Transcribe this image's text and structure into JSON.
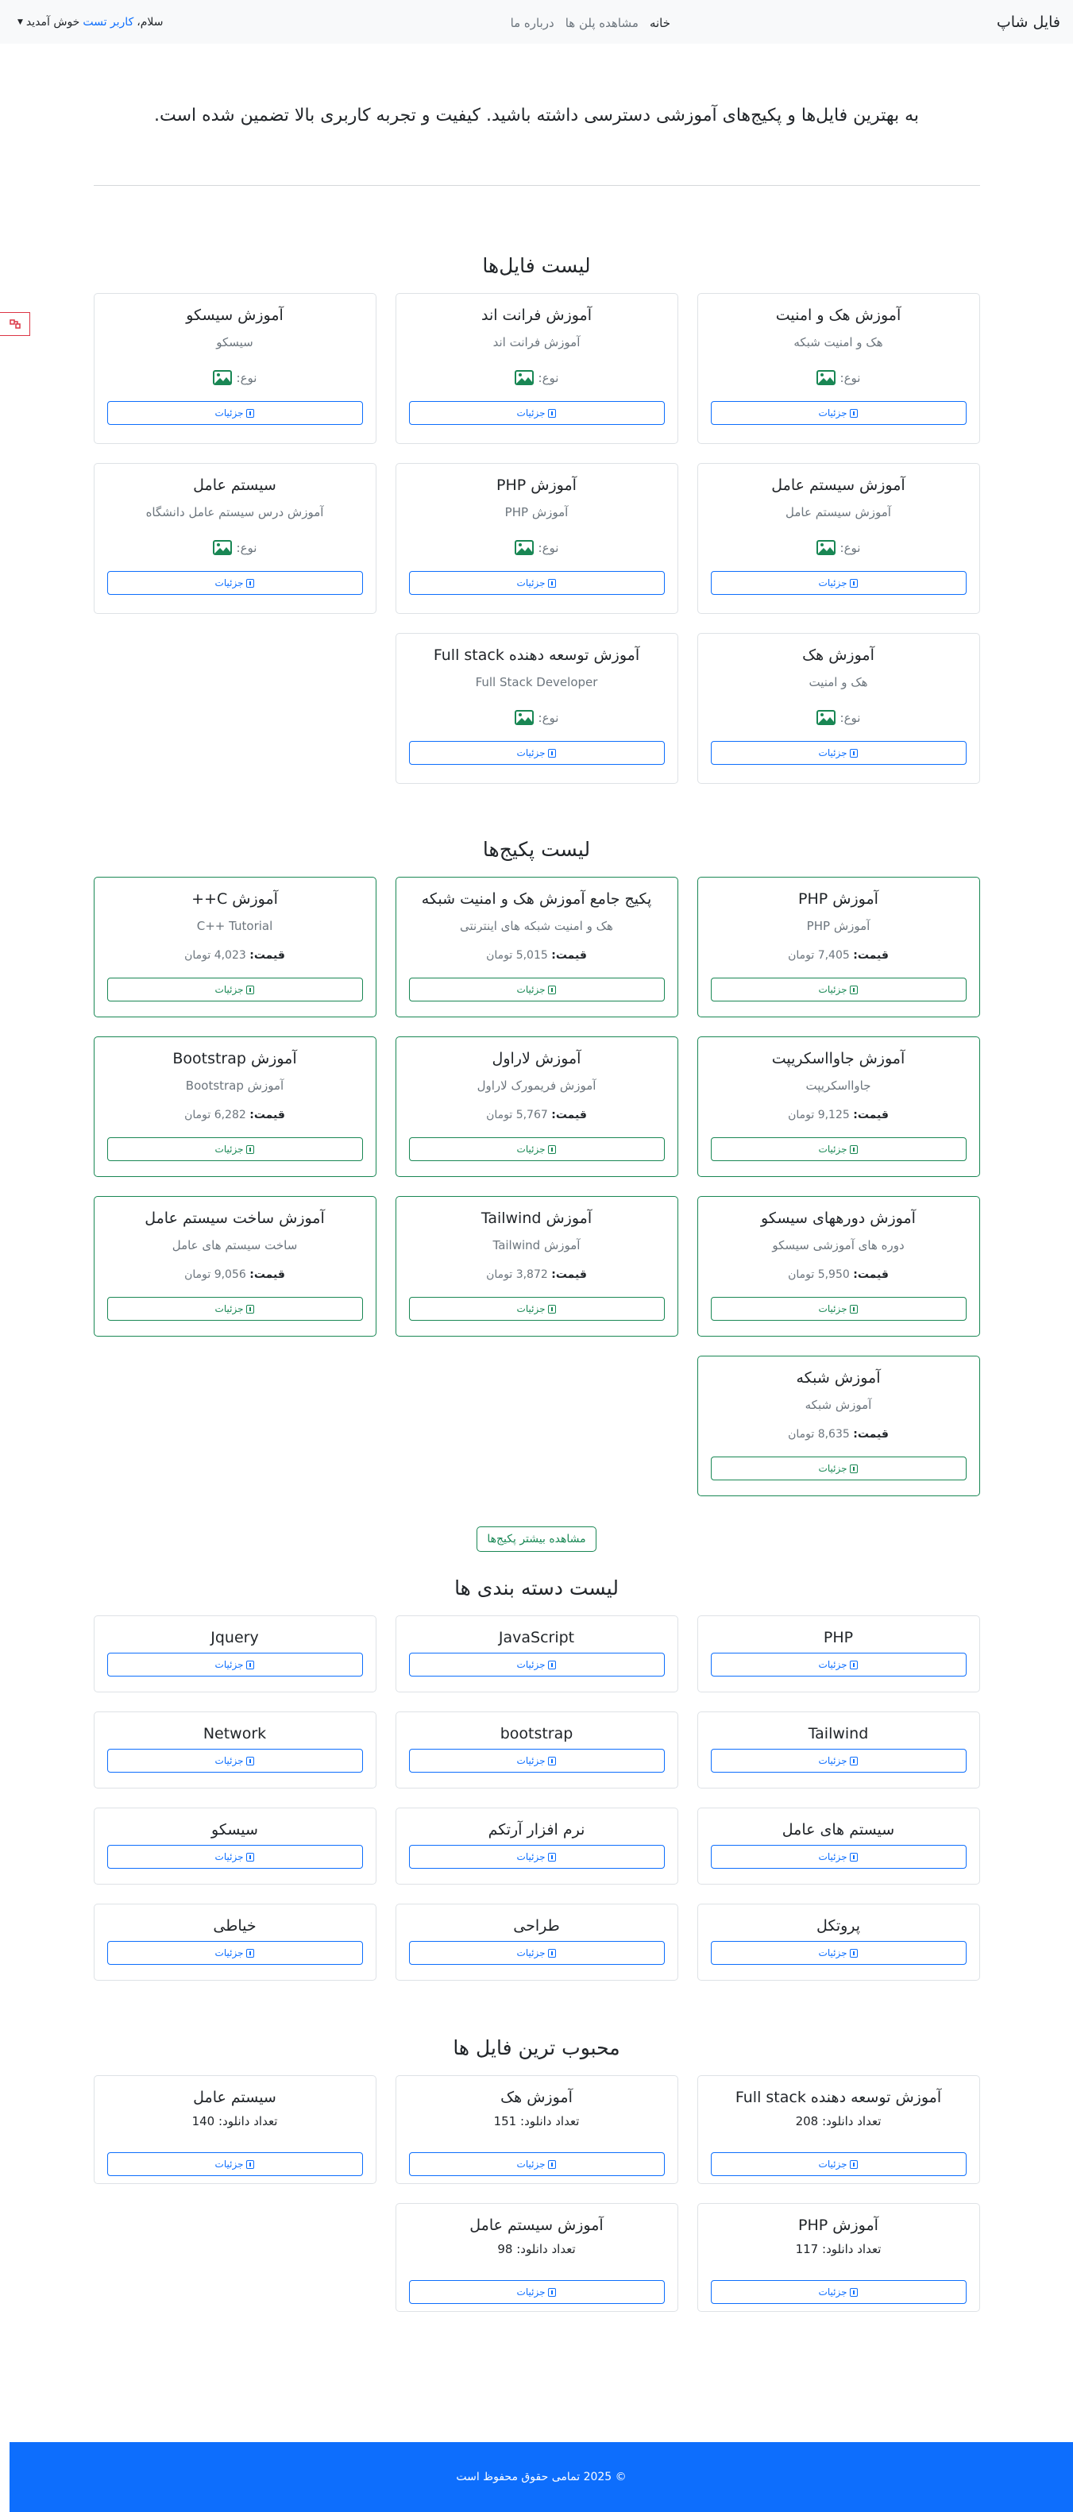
{
  "header": {
    "brand": "فایل شاپ",
    "nav": [
      {
        "label": "خانه",
        "active": true
      },
      {
        "label": "مشاهده پلن ها",
        "active": false
      },
      {
        "label": "درباره ما",
        "active": false
      }
    ],
    "greeting_prefix": "سلام،",
    "user_name": "کاربر تست",
    "greeting_suffix": "خوش آمدید"
  },
  "intro": "به بهترین فایل‌ها و پکیج‌های آموزشی دسترسی داشته باشید. کیفیت و تجربه کاربری بالا تضمین شده است.",
  "files_section": {
    "title": "لیست فایل‌ها",
    "type_label": "نوع:",
    "details_label": "جزئیات",
    "items": [
      {
        "title": "آموزش هک و امنیت",
        "subtitle": "هک و امنیت شبکه",
        "type_icon": "image-icon"
      },
      {
        "title": "آموزش فرانت اند",
        "subtitle": "آموزش فرانت اند",
        "type_icon": "image-icon"
      },
      {
        "title": "آموزش سیسکو",
        "subtitle": "سیسکو",
        "type_icon": "image-icon"
      },
      {
        "title": "آموزش سیستم عامل",
        "subtitle": "آموزش سیستم عامل",
        "type_icon": "image-icon"
      },
      {
        "title": "آموزش PHP",
        "subtitle": "آموزش PHP",
        "type_icon": "image-icon"
      },
      {
        "title": "سیستم عامل",
        "subtitle": "آموزش درس سیستم عامل دانشگاه",
        "type_icon": "image-icon"
      },
      {
        "title": "آموزش هک",
        "subtitle": "هک و امنیت",
        "type_icon": "image-icon"
      },
      {
        "title": "آموزش توسعه دهنده Full stack",
        "subtitle": "Full Stack Developer",
        "type_icon": "image-icon"
      }
    ]
  },
  "packages_section": {
    "title": "لیست پکیج‌ها",
    "price_label": "قیمت:",
    "details_label": "جزئیات",
    "more_button": "مشاهده بیشتر پکیج‌ها",
    "items": [
      {
        "title": "آموزش PHP",
        "subtitle": "آموزش PHP",
        "price": "7,405 تومان"
      },
      {
        "title": "پکیج جامع آموزش هک و امنیت شبکه",
        "subtitle": "هک و امنیت شبکه های اینترنتی",
        "price": "5,015 تومان"
      },
      {
        "title": "آموزش C++",
        "subtitle": "C++ Tutorial",
        "price": "4,023 تومان"
      },
      {
        "title": "آموزش جاوااسکریپت",
        "subtitle": "جاوااسکریپت",
        "price": "9,125 تومان"
      },
      {
        "title": "آموزش لاراول",
        "subtitle": "آموزش فریمورک لاراول",
        "price": "5,767 تومان"
      },
      {
        "title": "آموزش Bootstrap",
        "subtitle": "آموزش Bootstrap",
        "price": "6,282 تومان"
      },
      {
        "title": "آموزش دورههای سیسکو",
        "subtitle": "دوره های آموزشی سیسکو",
        "price": "5,950 تومان"
      },
      {
        "title": "آموزش Tailwind",
        "subtitle": "آموزش Tailwind",
        "price": "3,872 تومان"
      },
      {
        "title": "آموزش ساخت سیستم عامل",
        "subtitle": "ساخت سیستم های عامل",
        "price": "9,056 تومان"
      },
      {
        "title": "آموزش شبکه",
        "subtitle": "آموزش شبکه",
        "price": "8,635 تومان"
      }
    ]
  },
  "categories_section": {
    "title": "لیست دسته بندی ها",
    "details_label": "جزئیات",
    "items": [
      "PHP",
      "JavaScript",
      "Jquery",
      "Tailwind",
      "bootstrap",
      "Network",
      "سیستم های عامل",
      "نرم افزار آرتکم",
      "سیسکو",
      "پروتکل",
      "طراحی",
      "خیاطی"
    ]
  },
  "popular_section": {
    "title": "محبوب ترین فایل ها",
    "downloads_label": "تعداد دانلود:",
    "details_label": "جزئیات",
    "items": [
      {
        "title": "آموزش توسعه دهنده Full stack",
        "downloads": "208"
      },
      {
        "title": "آموزش هک",
        "downloads": "151"
      },
      {
        "title": "سیستم عامل",
        "downloads": "140"
      },
      {
        "title": "آموزش PHP",
        "downloads": "117"
      },
      {
        "title": "آموزش سیستم عامل",
        "downloads": "98"
      }
    ]
  },
  "footer": {
    "text": "© 2025 تمامی حقوق محفوظ است"
  },
  "colors": {
    "primary": "#0d6efd",
    "success": "#198754",
    "navbar_bg": "#f8f9fa",
    "muted": "#6c757d"
  }
}
